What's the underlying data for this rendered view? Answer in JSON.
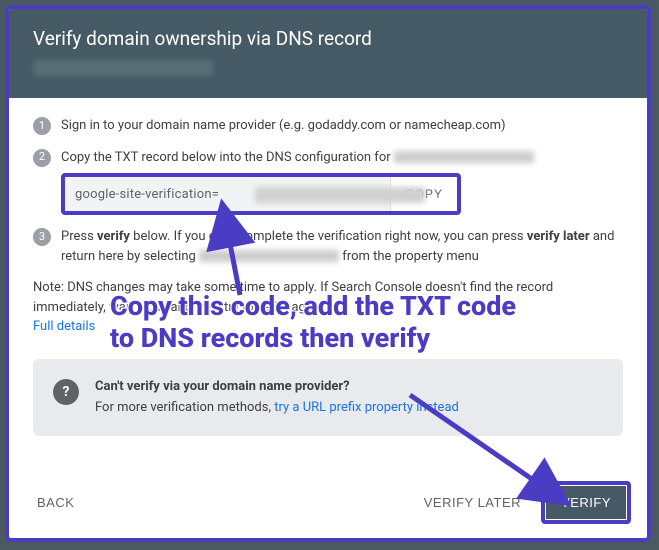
{
  "header": {
    "title": "Verify domain ownership via DNS record"
  },
  "steps": {
    "one": {
      "num": "1",
      "text": "Sign in to your domain name provider (e.g. godaddy.com or namecheap.com)"
    },
    "two": {
      "num": "2",
      "text_a": "Copy the TXT record below into the DNS configuration for ",
      "txt_value": "google-site-verification=",
      "copy_label": "COPY"
    },
    "three": {
      "num": "3",
      "t1": "Press ",
      "t2": "verify",
      "t3": " below. If you can't complete the verification right now, you can press ",
      "t4": "verify later",
      "t5": " and return here by selecting ",
      "t6": " from the property menu"
    }
  },
  "note": {
    "t1": "Note: DNS changes may take some time to apply. If Search Console doesn't find the record immediately, wait a day and then try to verify again",
    "link": "Full details"
  },
  "info": {
    "title": "Can't verify via your domain name provider?",
    "body_a": "For more verification methods, ",
    "link": "try a URL prefix property instead"
  },
  "footer": {
    "back": "BACK",
    "later": "VERIFY LATER",
    "verify": "VERIFY"
  },
  "annotation": {
    "text": "Copy this code, add the TXT code to DNS records then verify"
  }
}
